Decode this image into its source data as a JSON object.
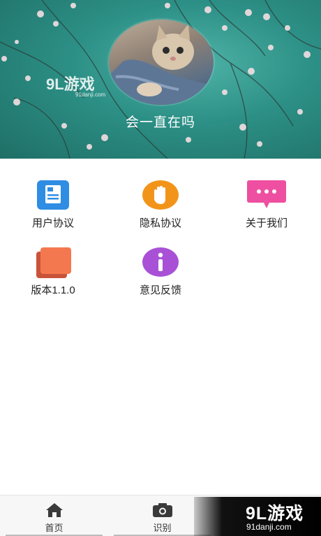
{
  "header": {
    "username": "会一直在吗",
    "watermark": {
      "logo": "9L游戏",
      "url": "91danji.com"
    },
    "avatar_icon": "cat-photo"
  },
  "menu": [
    {
      "label": "用户协议",
      "icon": "document-icon",
      "color": "#2f8de4"
    },
    {
      "label": "隐私协议",
      "icon": "hand-icon",
      "color": "#f2941a"
    },
    {
      "label": "关于我们",
      "icon": "chat-bubble-icon",
      "color": "#ee4fa0"
    },
    {
      "label": "版本1.1.0",
      "icon": "stacked-cards-icon",
      "color": "#ee6a3d"
    },
    {
      "label": "意见反馈",
      "icon": "info-icon",
      "color": "#a951d6"
    }
  ],
  "bottom_nav": [
    {
      "label": "首页",
      "icon": "home-icon"
    },
    {
      "label": "识别",
      "icon": "camera-icon"
    }
  ],
  "brand_overlay": {
    "logo": "9L游戏",
    "url": "91danji.com"
  }
}
